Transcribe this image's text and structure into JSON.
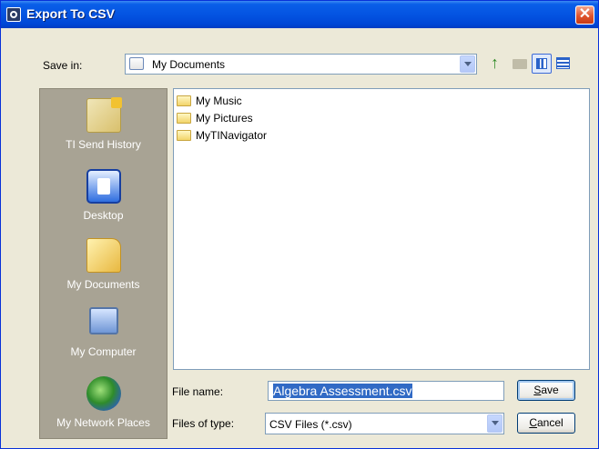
{
  "window": {
    "title": "Export To CSV",
    "close_glyph": "✕"
  },
  "toolbar": {
    "save_in_label": "Save in:",
    "location": "My Documents",
    "buttons": [
      "up-one-level-icon",
      "create-new-folder-icon",
      "view-menu-icon",
      "details-view-icon"
    ]
  },
  "places": [
    {
      "label": "TI Send History",
      "icon": "ti-send-history-icon"
    },
    {
      "label": "Desktop",
      "icon": "desktop-icon"
    },
    {
      "label": "My Documents",
      "icon": "my-documents-icon"
    },
    {
      "label": "My Computer",
      "icon": "my-computer-icon"
    },
    {
      "label": "My Network Places",
      "icon": "my-network-places-icon"
    }
  ],
  "files": [
    {
      "name": "My Music",
      "icon": "folder-icon"
    },
    {
      "name": "My Pictures",
      "icon": "folder-icon"
    },
    {
      "name": "MyTINavigator",
      "icon": "folder-icon"
    }
  ],
  "form": {
    "file_name_label": "File name:",
    "file_name_value": "Algebra Assessment.csv",
    "file_type_label": "Files of type:",
    "file_type_value": "CSV Files (*.csv)"
  },
  "buttons": {
    "save_mnemonic": "S",
    "save_rest": "ave",
    "cancel_mnemonic": "C",
    "cancel_rest": "ancel"
  },
  "colors": {
    "title_bar": "#0454e2",
    "places_bar": "#a8a394",
    "selection": "#316ac5",
    "dialog_bg": "#ece9d8"
  }
}
